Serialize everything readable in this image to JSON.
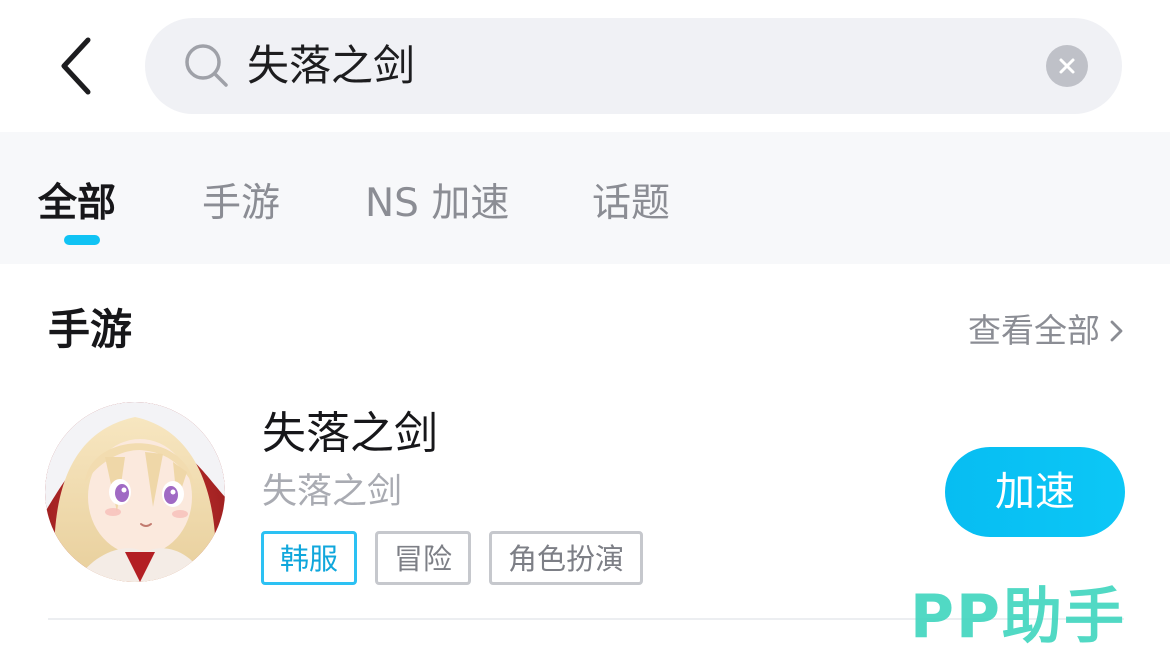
{
  "search": {
    "query": "失落之剑"
  },
  "tabs": [
    {
      "label": "全部",
      "active": true
    },
    {
      "label": "手游",
      "active": false
    },
    {
      "label": "NS 加速",
      "active": false
    },
    {
      "label": "话题",
      "active": false
    }
  ],
  "section": {
    "title": "手游",
    "view_all": "查看全部"
  },
  "game": {
    "name": "失落之剑",
    "subtitle": "失落之剑",
    "tags": [
      "韩服",
      "冒险",
      "角色扮演"
    ],
    "action_label": "加速"
  },
  "watermark": "PP助手",
  "colors": {
    "accent": "#10c3f4",
    "watermark": "#43d6c0"
  }
}
